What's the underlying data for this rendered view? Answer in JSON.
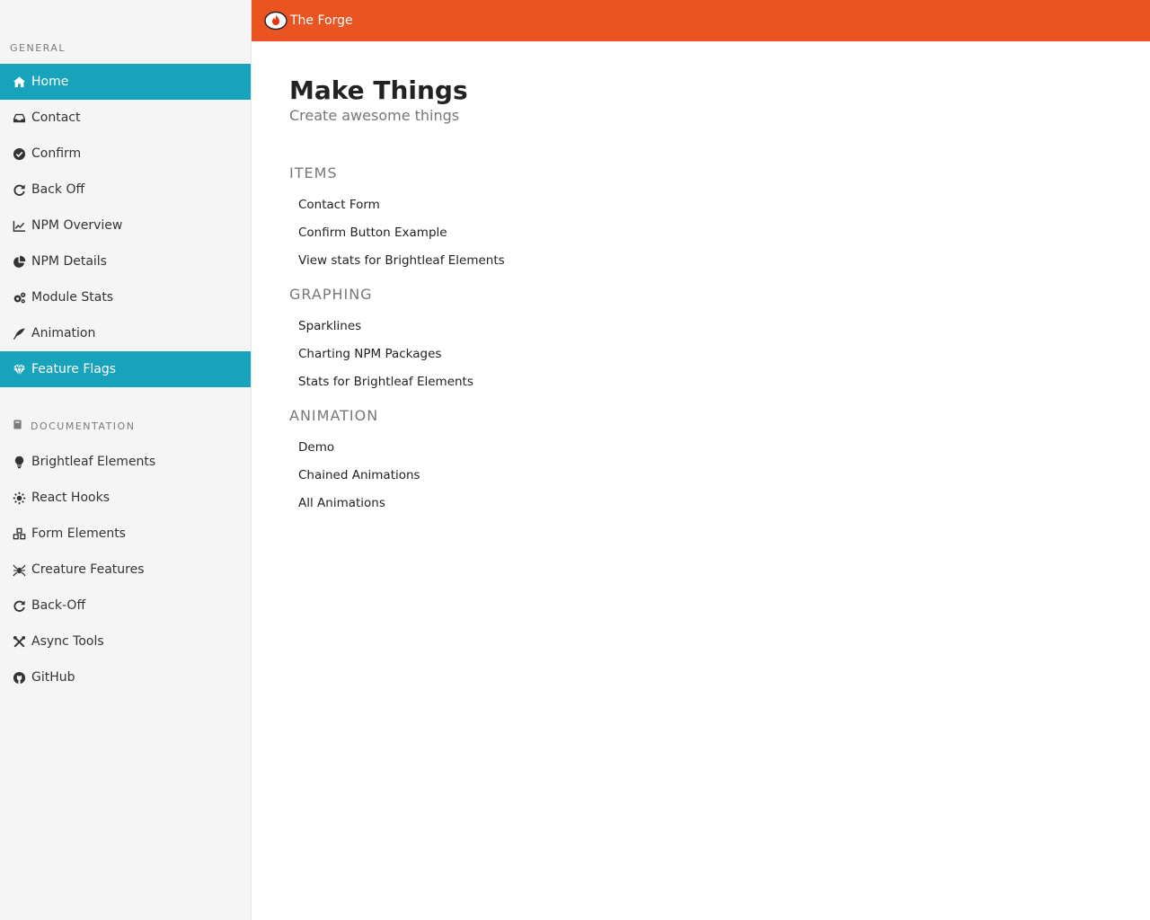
{
  "app": {
    "brand": "The Forge",
    "colors": {
      "accent": "#e95420",
      "active": "#18a3bc"
    }
  },
  "sidebar": {
    "general_label": "GENERAL",
    "general_items": [
      {
        "label": "Home",
        "icon": "home-icon",
        "active": true
      },
      {
        "label": "Contact",
        "icon": "inbox-icon",
        "active": false
      },
      {
        "label": "Confirm",
        "icon": "check-circle-icon",
        "active": false
      },
      {
        "label": "Back Off",
        "icon": "redo-icon",
        "active": false
      },
      {
        "label": "NPM Overview",
        "icon": "line-chart-icon",
        "active": false
      },
      {
        "label": "NPM Details",
        "icon": "pie-chart-icon",
        "active": false
      },
      {
        "label": "Module Stats",
        "icon": "cogs-icon",
        "active": false
      },
      {
        "label": "Animation",
        "icon": "feather-icon",
        "active": false
      },
      {
        "label": "Feature Flags",
        "icon": "gem-icon",
        "active": true
      }
    ],
    "docs_label": "DOCUMENTATION",
    "docs_items": [
      {
        "label": "Brightleaf Elements",
        "icon": "lightbulb-icon"
      },
      {
        "label": "React Hooks",
        "icon": "sun-icon"
      },
      {
        "label": "Form Elements",
        "icon": "cubes-icon"
      },
      {
        "label": "Creature Features",
        "icon": "spider-icon"
      },
      {
        "label": "Back-Off",
        "icon": "redo-icon"
      },
      {
        "label": "Async Tools",
        "icon": "tools-icon"
      },
      {
        "label": "GitHub",
        "icon": "github-icon"
      }
    ]
  },
  "main": {
    "title": "Make Things",
    "subtitle": "Create awesome things",
    "sections": [
      {
        "heading": "ITEMS",
        "links": [
          "Contact Form",
          "Confirm Button Example",
          "View stats for Brightleaf Elements"
        ]
      },
      {
        "heading": "GRAPHING",
        "links": [
          "Sparklines",
          "Charting NPM Packages",
          "Stats for Brightleaf Elements"
        ]
      },
      {
        "heading": "ANIMATION",
        "links": [
          "Demo",
          "Chained Animations",
          "All Animations"
        ]
      }
    ]
  }
}
